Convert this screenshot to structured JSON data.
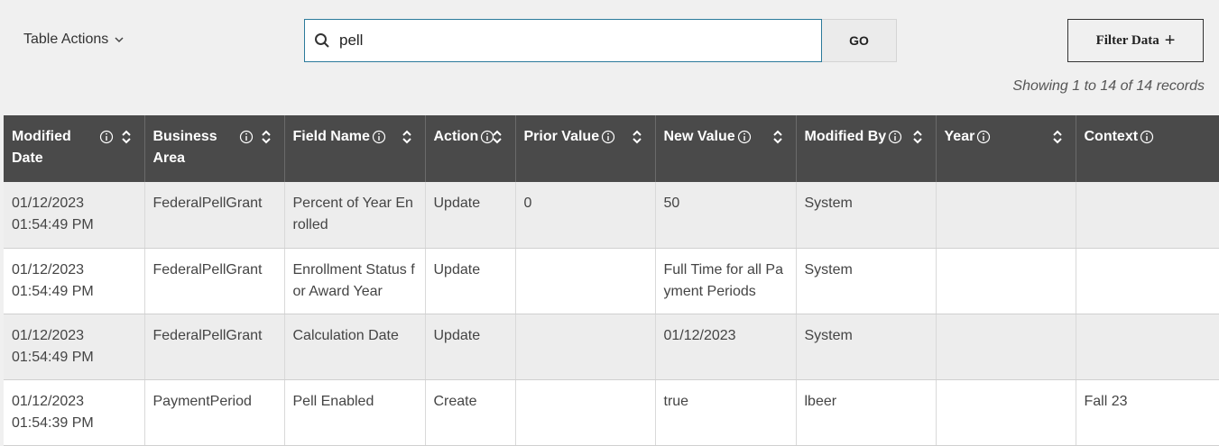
{
  "toolbar": {
    "table_actions_label": "Table Actions",
    "search_value": "pell",
    "go_label": "GO",
    "filter_label": "Filter Data",
    "filter_plus": "+",
    "records_text": "Showing 1 to 14 of 14 records"
  },
  "columns": [
    {
      "label": "Modified Date",
      "sortable": true
    },
    {
      "label": "Business Area",
      "sortable": true
    },
    {
      "label": "Field Name",
      "sortable": true
    },
    {
      "label": "Action",
      "sortable": true
    },
    {
      "label": "Prior Value",
      "sortable": true
    },
    {
      "label": "New Value",
      "sortable": true
    },
    {
      "label": "Modified By",
      "sortable": true
    },
    {
      "label": "Year",
      "sortable": true
    },
    {
      "label": "Context",
      "sortable": false
    }
  ],
  "rows": [
    {
      "date": "01/12/2023",
      "time": "01:54:49 PM",
      "business_area": "FederalPellGrant",
      "field_name": "Percent of Year Enrolled",
      "action": "Update",
      "prior_value": "0",
      "new_value": "50",
      "modified_by": "System",
      "year": "",
      "context": ""
    },
    {
      "date": "01/12/2023",
      "time": "01:54:49 PM",
      "business_area": "FederalPellGrant",
      "field_name": "Enrollment Status for Award Year",
      "action": "Update",
      "prior_value": "",
      "new_value": "Full Time for all Payment Periods",
      "modified_by": "System",
      "year": "",
      "context": ""
    },
    {
      "date": "01/12/2023",
      "time": "01:54:49 PM",
      "business_area": "FederalPellGrant",
      "field_name": "Calculation Date",
      "action": "Update",
      "prior_value": "",
      "new_value": "01/12/2023",
      "modified_by": "System",
      "year": "",
      "context": ""
    },
    {
      "date": "01/12/2023",
      "time": "01:54:39 PM",
      "business_area": "PaymentPeriod",
      "field_name": "Pell Enabled",
      "action": "Create",
      "prior_value": "",
      "new_value": "true",
      "modified_by": "lbeer",
      "year": "",
      "context": "Fall 23"
    }
  ],
  "colors": {
    "header_bg": "#4a4a4a",
    "row_odd": "#ededed",
    "row_even": "#ffffff",
    "search_border": "#2b7a9b"
  },
  "icons": {
    "search": "search-icon",
    "chevron": "chevron-down-icon",
    "info": "info-icon",
    "sort": "sort-icon"
  }
}
